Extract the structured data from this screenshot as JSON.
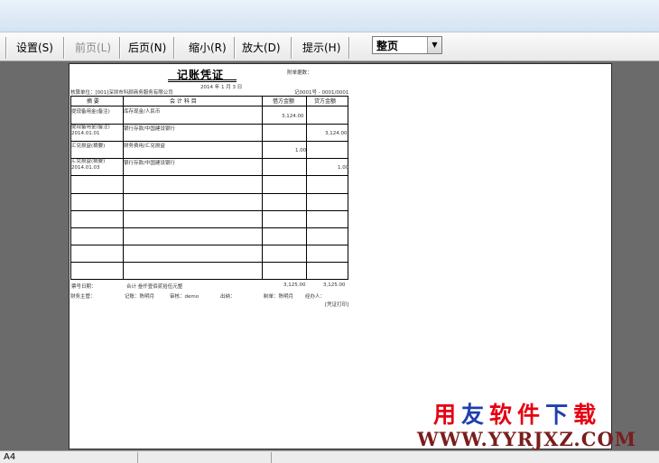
{
  "toolbar": {
    "buttons": [
      {
        "label": "设置(S)",
        "enabled": true
      },
      {
        "label": "前页(L)",
        "enabled": false
      },
      {
        "label": "后页(N)",
        "enabled": true
      },
      {
        "label": "缩小(R)",
        "enabled": true
      },
      {
        "label": "放大(D)",
        "enabled": true
      },
      {
        "label": "提示(H)",
        "enabled": true
      }
    ],
    "view_select": "整页"
  },
  "voucher": {
    "title": "记账凭证",
    "date": "2014 年  1  月  3  日",
    "header_right": "附单据数：",
    "header_left": "核算单位：[001]深圳市科颜商务服务有限公司",
    "voucher_no": "记0001号 - 0001/0001",
    "col_summary": "摘  要",
    "col_account": "会 计 科 目",
    "col_debit": "借方金额",
    "col_credit": "贷方金额",
    "rows": [
      {
        "summary": "提现备用金(备注)",
        "account": "库存现金/人民币",
        "debit": "3,124.00",
        "credit": ""
      },
      {
        "summary": "提现备用金(备注)\n2014.01.01",
        "account": "银行存款/中国建设银行",
        "debit": "",
        "credit": "3,124.00"
      },
      {
        "summary": "汇兑损益(摘要)",
        "account": "财务费用/汇兑损益",
        "debit": "1.00",
        "credit": ""
      },
      {
        "summary": "汇兑损益(摘要)\n2014.01.03",
        "account": "银行存款/中国建设银行",
        "debit": "",
        "credit": "1.00"
      }
    ],
    "total_label": "票号日期：",
    "total_text": "合计 叁仟壹佰贰拾伍元整",
    "total_debit": "3,125.00",
    "total_credit": "3,125.00",
    "footer": {
      "manager": "财务主管：",
      "bookkeeper": "记账：陈明月",
      "audit": "审核：demo",
      "cashier": "出纳：",
      "maker": "制单：陈明月",
      "handler": "经办人：",
      "page": "[凭证打印]"
    }
  },
  "statusbar": {
    "paper_size": "A4"
  },
  "watermark": {
    "chars": [
      {
        "text": "用",
        "color": "#e60012"
      },
      {
        "text": "友",
        "color": "#1e3fae"
      },
      {
        "text": "软",
        "color": "#e60012"
      },
      {
        "text": "件",
        "color": "#e60012"
      },
      {
        "text": "下",
        "color": "#1e3fae"
      },
      {
        "text": "载",
        "color": "#e60012"
      }
    ],
    "url": "WWW.YYRJXZ.COM"
  }
}
